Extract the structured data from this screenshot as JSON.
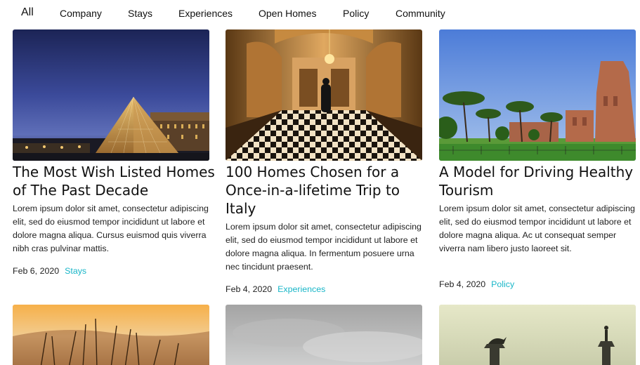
{
  "nav": {
    "items": [
      "All",
      "Company",
      "Stays",
      "Experiences",
      "Open Homes",
      "Policy",
      "Community"
    ]
  },
  "cards": [
    {
      "title": "The Most Wish Listed Homes of The Past Decade",
      "text": "Lorem ipsum dolor sit amet, consectetur adipiscing elit, sed do eiusmod tempor incididunt ut labore et dolore magna aliqua. Cursus euismod quis viverra nibh cras pulvinar mattis.",
      "date": "Feb 6, 2020",
      "tag": "Stays",
      "image": "louvre-pyramid-night-photo"
    },
    {
      "title": "100 Homes Chosen for a Once-in-a-lifetime Trip to Italy",
      "text": "Lorem ipsum dolor sit amet, consectetur adipiscing elit, sed do eiusmod tempor incididunt ut labore et dolore magna aliqua. In fermentum posuere urna nec tincidunt praesent.",
      "date": "Feb 4, 2020",
      "tag": "Experiences",
      "image": "palace-hallway-checkered-floor-photo"
    },
    {
      "title": "A Model for Driving Healthy Tourism",
      "text": "Lorem ipsum dolor sit amet, consectetur adipiscing elit, sed do eiusmod tempor incididunt ut labore et dolore magna aliqua. Ac ut consequat semper viverra nam libero justo laoreet sit.",
      "date": "Feb 4, 2020",
      "tag": "Policy",
      "image": "roman-ruins-pine-trees-photo"
    }
  ],
  "second_row": [
    {
      "image": "grass-sunset-photo"
    },
    {
      "image": "cloudy-sky-photo"
    },
    {
      "image": "venice-columns-photo"
    }
  ],
  "colors": {
    "tag": "#19b6c8",
    "text": "#111111"
  }
}
